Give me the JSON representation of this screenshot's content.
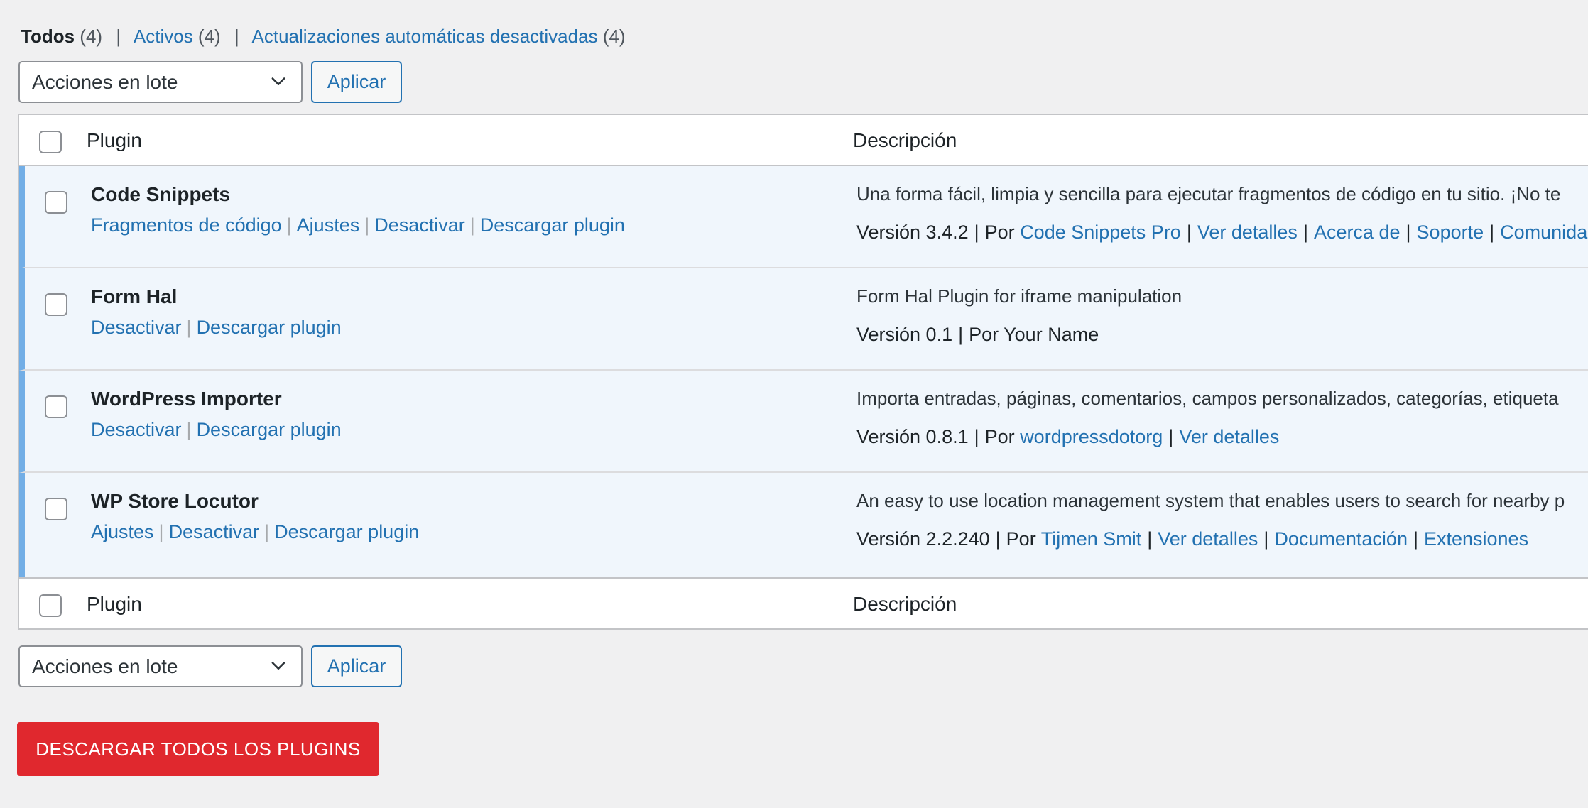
{
  "filters": {
    "all_label": "Todos",
    "all_count": "(4)",
    "active_label": "Activos",
    "active_count": "(4)",
    "auto_off_label": "Actualizaciones automáticas desactivadas",
    "auto_off_count": "(4)",
    "separator": "|"
  },
  "bulk": {
    "select_value": "Acciones en lote",
    "apply_label": "Aplicar"
  },
  "table": {
    "col_plugin": "Plugin",
    "col_description": "Descripción"
  },
  "plugins": [
    {
      "name": "Code Snippets",
      "actions": [
        "Fragmentos de código",
        "Ajustes",
        "Desactivar",
        "Descargar plugin"
      ],
      "description": "Una forma fácil, limpia y sencilla para ejecutar fragmentos de código en tu sitio. ¡No te",
      "version": "Versión 3.4.2",
      "by": "Por",
      "author": "Code Snippets Pro",
      "links": [
        "Ver detalles",
        "Acerca de",
        "Soporte",
        "Comunidad"
      ]
    },
    {
      "name": "Form Hal",
      "actions": [
        "Desactivar",
        "Descargar plugin"
      ],
      "description": "Form Hal Plugin for iframe manipulation",
      "version": "Versión 0.1",
      "by": "Por Your Name"
    },
    {
      "name": "WordPress Importer",
      "actions": [
        "Desactivar",
        "Descargar plugin"
      ],
      "description": "Importa entradas, páginas, comentarios, campos personalizados, categorías, etiqueta",
      "version": "Versión 0.8.1",
      "by": "Por",
      "author": "wordpressdotorg",
      "links": [
        "Ver detalles"
      ]
    },
    {
      "name": "WP Store Locutor",
      "actions": [
        "Ajustes",
        "Desactivar",
        "Descargar plugin"
      ],
      "description": "An easy to use location management system that enables users to search for nearby p",
      "version": "Versión 2.2.240",
      "by": "Por",
      "author": "Tijmen Smit",
      "links": [
        "Ver detalles",
        "Documentación",
        "Extensiones"
      ]
    }
  ],
  "download_all_label": "DESCARGAR TODOS LOS PLUGINS",
  "colors": {
    "link": "#2271b1",
    "active_row_bg": "#f0f6fc",
    "active_border": "#72aee6",
    "download_button": "#e0282e"
  },
  "icons": {
    "select_chevron": "chevron-down-icon"
  }
}
